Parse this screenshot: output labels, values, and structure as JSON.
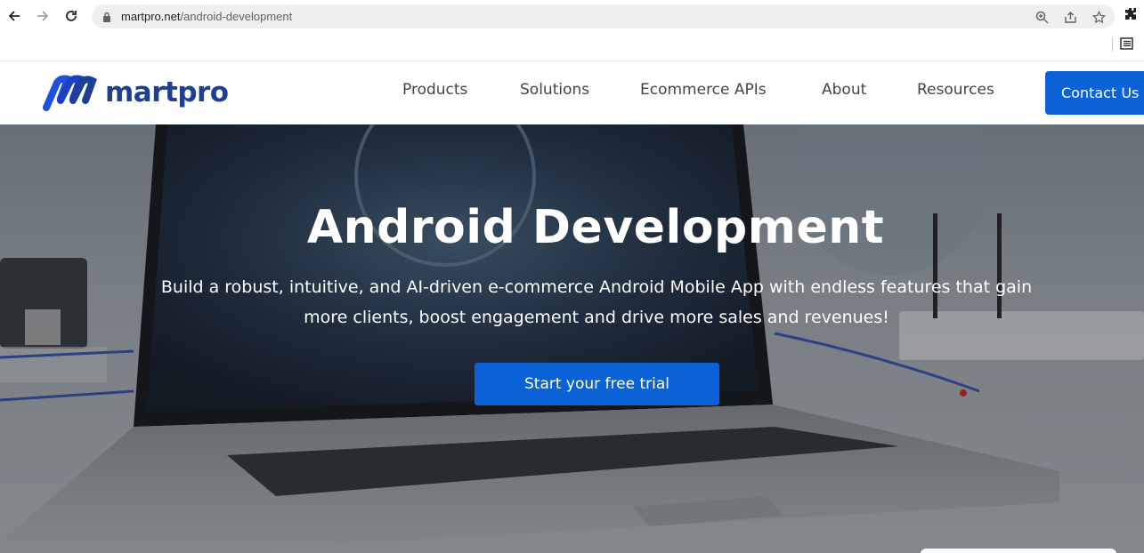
{
  "browser": {
    "url_host": "martpro.net",
    "url_path": "/android-development",
    "icons": [
      "back-arrow-icon",
      "forward-arrow-icon",
      "reload-icon",
      "lock-icon",
      "zoom-icon",
      "share-icon",
      "star-icon",
      "extensions-icon",
      "reading-list-icon"
    ]
  },
  "header": {
    "logo_text": "martpro",
    "nav": [
      "Products",
      "Solutions",
      "Ecommerce APIs",
      "About",
      "Resources"
    ],
    "contact_label": "Contact Us"
  },
  "hero": {
    "title": "Android Development",
    "subtitle_line1": "Build a robust, intuitive, and AI-driven e-commerce Android Mobile App with endless features that gain",
    "subtitle_line2": "more clients, boost engagement and drive more sales and revenues!",
    "cta_label": "Start your free trial"
  },
  "colors": {
    "brand_blue": "#0b62d6",
    "logo_navy": "#1f3f95"
  }
}
